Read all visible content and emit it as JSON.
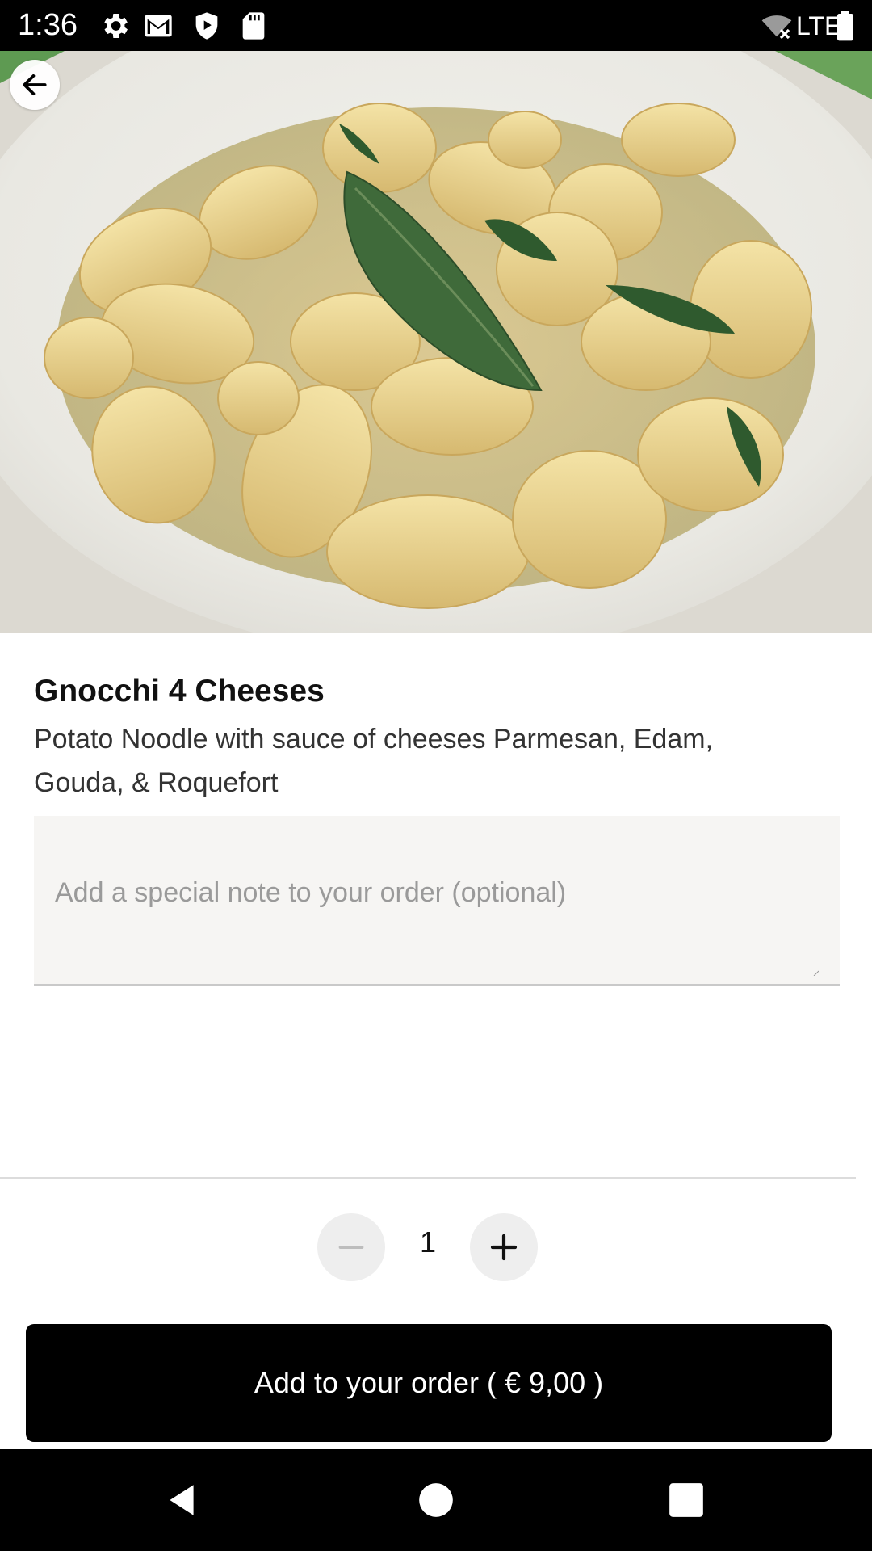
{
  "status_bar": {
    "time": "1:36",
    "network": "LTE",
    "icons": [
      "settings-icon",
      "gmail-icon",
      "shield-icon",
      "sd-card-icon",
      "wifi-off-icon",
      "signal-icon",
      "battery-icon"
    ]
  },
  "header": {
    "back_icon": "arrow-left-icon"
  },
  "item": {
    "name": "Gnocchi 4 Cheeses",
    "description": "Potato Noodle with sauce of cheeses Parmesan, Edam, Gouda, & Roquefort"
  },
  "note": {
    "placeholder": "Add a special note to your order (optional)",
    "value": ""
  },
  "quantity": {
    "value": "1",
    "decrement_icon": "minus-icon",
    "increment_icon": "plus-icon"
  },
  "order_button": {
    "label": "Add to your order ( € 9,00 )"
  },
  "nav_bar": {
    "icons": [
      "back-triangle-icon",
      "home-circle-icon",
      "recents-square-icon"
    ]
  },
  "colors": {
    "primary": "#000000",
    "background": "#ffffff",
    "note_background": "#f6f5f3",
    "qty_button": "#eeeeee"
  }
}
